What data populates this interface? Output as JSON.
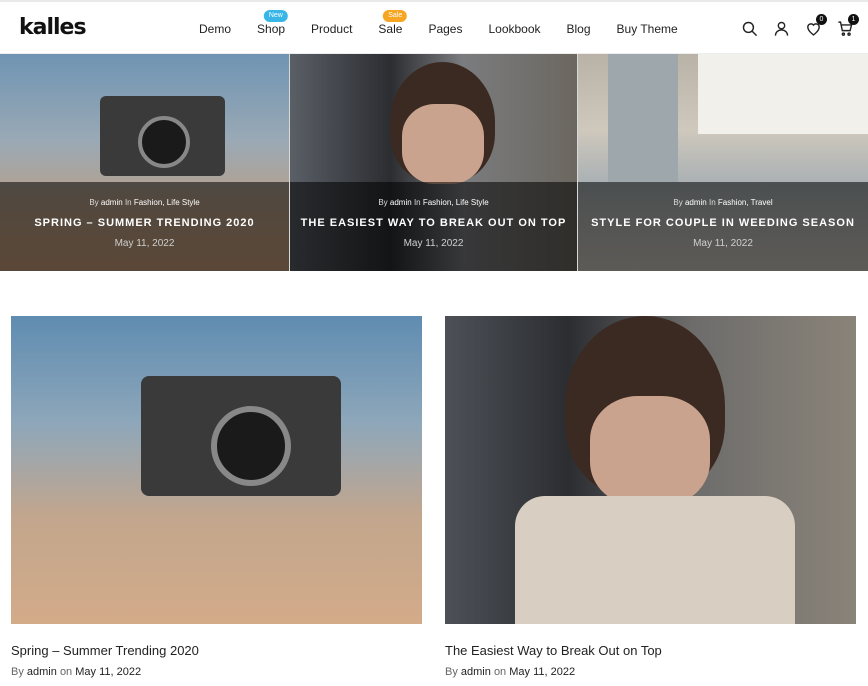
{
  "header": {
    "logo": "kalles",
    "nav": [
      {
        "label": "Demo",
        "badge": ""
      },
      {
        "label": "Shop",
        "badge": "New"
      },
      {
        "label": "Product",
        "badge": ""
      },
      {
        "label": "Sale",
        "badge": "Sale"
      },
      {
        "label": "Pages",
        "badge": ""
      },
      {
        "label": "Lookbook",
        "badge": ""
      },
      {
        "label": "Blog",
        "badge": ""
      },
      {
        "label": "Buy Theme",
        "badge": ""
      }
    ],
    "wishlist_count": "0",
    "cart_count": "1"
  },
  "featured": [
    {
      "by": "By",
      "author": "admin",
      "in": "In",
      "categories": "Fashion, Life Style",
      "title": "SPRING – SUMMER TRENDING 2020",
      "date": "May 11, 2022"
    },
    {
      "by": "By",
      "author": "admin",
      "in": "In",
      "categories": "Fashion, Life Style",
      "title": "THE EASIEST WAY TO BREAK OUT ON TOP",
      "date": "May 11, 2022"
    },
    {
      "by": "By",
      "author": "admin",
      "in": "In",
      "categories": "Fashion, Travel",
      "title": "STYLE FOR COUPLE IN WEEDING SEASON",
      "date": "May 11, 2022"
    }
  ],
  "posts": [
    {
      "title": "Spring – Summer Trending 2020",
      "by": "By",
      "author": "admin",
      "on": "on",
      "date": "May 11, 2022"
    },
    {
      "title": "The Easiest Way to Break Out on Top",
      "by": "By",
      "author": "admin",
      "on": "on",
      "date": "May 11, 2022"
    }
  ],
  "colors": {
    "new_badge": "#38b6e8",
    "sale_badge": "#f6a623",
    "accent": "#111111"
  }
}
